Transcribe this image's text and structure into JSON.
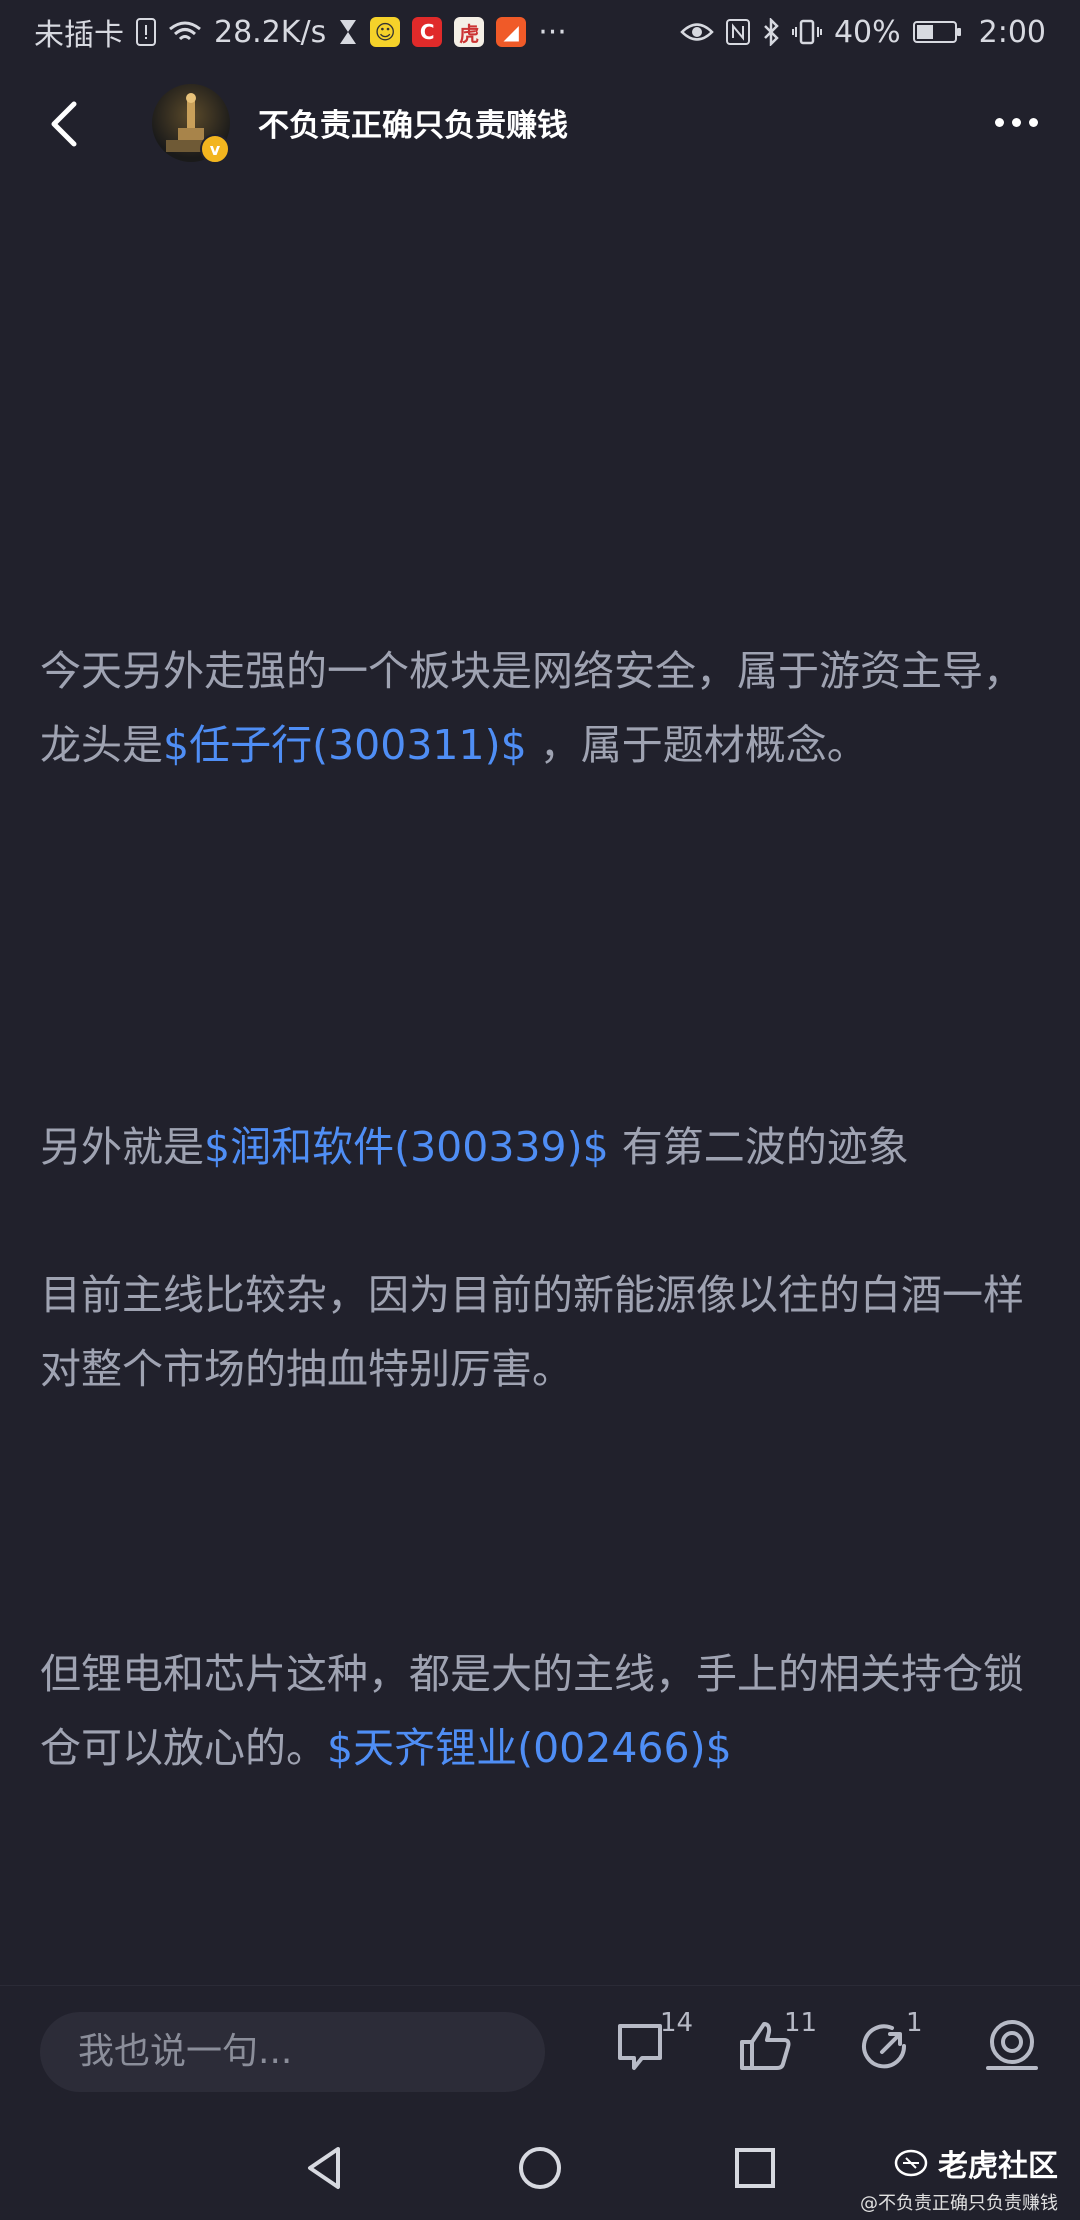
{
  "status_bar": {
    "carrier": "未插卡",
    "net_speed": "28.2K/s",
    "battery_percent": "40%",
    "battery_level": 0.4,
    "time": "2:00"
  },
  "header": {
    "title": "不负责正确只负责赚钱"
  },
  "post": {
    "p1_a": "今天另外走强的一个板块是网络安全，属于游资主导，龙头是",
    "p1_stock": "$任子行(300311)$",
    "p1_b": " ，属于题材概念。",
    "p2_a": "另外就是",
    "p2_stock": "$润和软件(300339)$",
    "p2_b": " 有第二波的迹象",
    "p3": "目前主线比较杂，因为目前的新能源像以往的白酒一样对整个市场的抽血特别厉害。",
    "p4_a": "但锂电和芯片这种，都是大的主线，手上的相关持仓锁仓可以放心的。",
    "p4_stock": "$天齐锂业(002466)$"
  },
  "actions": {
    "input_placeholder": "我也说一句...",
    "comment_count": "14",
    "like_count": "11",
    "share_count": "1"
  },
  "watermark": {
    "brand": "老虎社区",
    "author": "@不负责正确只负责赚钱"
  },
  "colors": {
    "background": "#21212c",
    "text": "#9fa3b2",
    "stock_link": "#4f8ef5"
  }
}
